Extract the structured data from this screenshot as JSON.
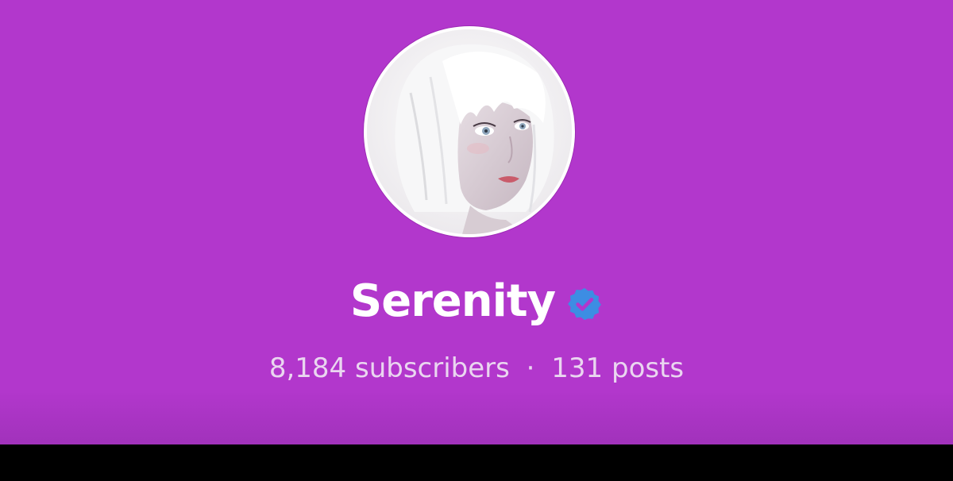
{
  "profile": {
    "name": "Serenity",
    "verified_icon": "verified-badge-icon",
    "subscribers": "8,184 subscribers",
    "separator": "·",
    "posts": "131 posts"
  },
  "colors": {
    "header_background": "#b237cc",
    "name_text": "#ffffff",
    "stats_text": "#ead6f0",
    "verified_badge": "#3d8de3",
    "bottom_bar": "#000000"
  }
}
